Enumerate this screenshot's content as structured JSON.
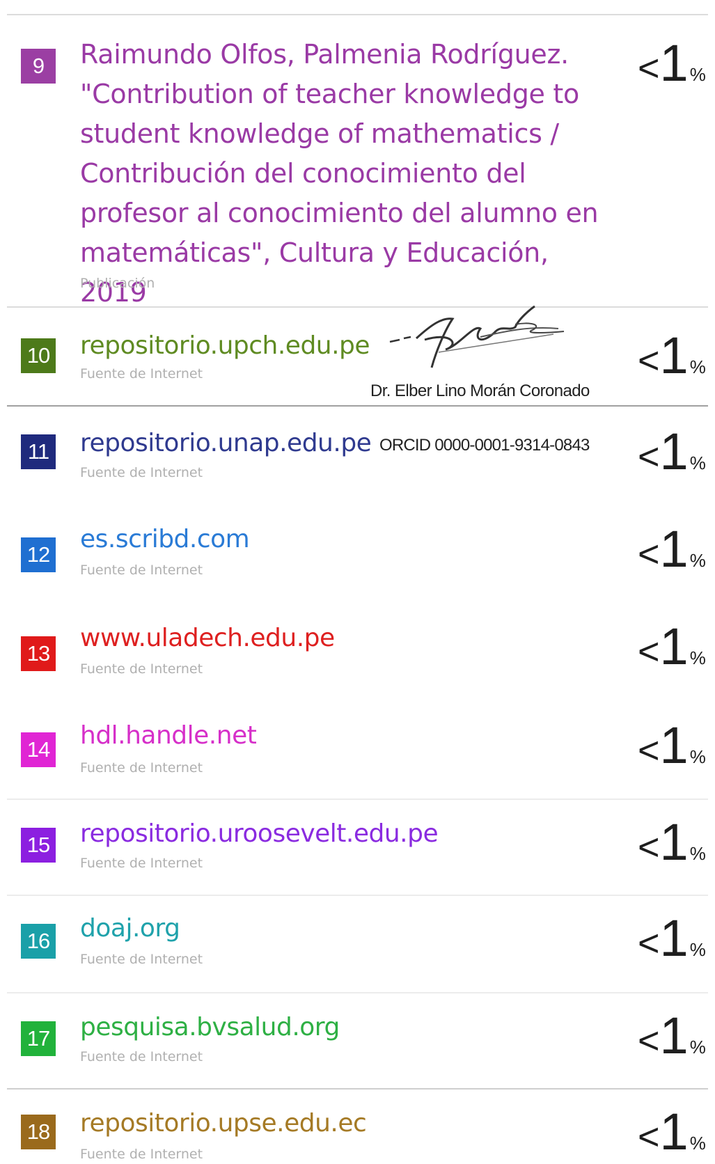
{
  "entries": [
    {
      "num": "9",
      "color": "#9b3fa3",
      "title": "Raimundo Olfos, Palmenia Rodríguez. \"Contribution of teacher knowledge to student knowledge of mathematics / Contribución del conocimiento del profesor al conocimiento del alumno en matemáticas\", Cultura y Educación, 2019",
      "type": "Publicación",
      "pct_lt": "<",
      "pct_num": "1",
      "pct_sym": "%"
    },
    {
      "num": "10",
      "color": "#4d7a1a",
      "title": "repositorio.upch.edu.pe",
      "type": "Fuente de Internet",
      "pct_lt": "<",
      "pct_num": "1",
      "pct_sym": "%"
    },
    {
      "num": "11",
      "color": "#1f2a7d",
      "title": "repositorio.unap.edu.pe",
      "type": "Fuente de Internet",
      "pct_lt": "<",
      "pct_num": "1",
      "pct_sym": "%"
    },
    {
      "num": "12",
      "color": "#1f6fd1",
      "title": "es.scribd.com",
      "type": "Fuente de Internet",
      "pct_lt": "<",
      "pct_num": "1",
      "pct_sym": "%"
    },
    {
      "num": "13",
      "color": "#e01a1a",
      "title": "www.uladech.edu.pe",
      "type": "Fuente de Internet",
      "pct_lt": "<",
      "pct_num": "1",
      "pct_sym": "%"
    },
    {
      "num": "14",
      "color": "#e025d4",
      "title": "hdl.handle.net",
      "type": "Fuente de Internet",
      "pct_lt": "<",
      "pct_num": "1",
      "pct_sym": "%"
    },
    {
      "num": "15",
      "color": "#8c1fe0",
      "title": "repositorio.uroosevelt.edu.pe",
      "type": "Fuente de Internet",
      "pct_lt": "<",
      "pct_num": "1",
      "pct_sym": "%"
    },
    {
      "num": "16",
      "color": "#1aa0a8",
      "title": "doaj.org",
      "type": "Fuente de Internet",
      "pct_lt": "<",
      "pct_num": "1",
      "pct_sym": "%"
    },
    {
      "num": "17",
      "color": "#21b23b",
      "title": "pesquisa.bvsalud.org",
      "type": "Fuente de Internet",
      "pct_lt": "<",
      "pct_num": "1",
      "pct_sym": "%"
    },
    {
      "num": "18",
      "color": "#9a6a1c",
      "title": "repositorio.upse.edu.ec",
      "type": "Fuente de Internet",
      "pct_lt": "<",
      "pct_num": "1",
      "pct_sym": "%"
    }
  ],
  "signature": {
    "name": "Dr. Elber Lino Morán Coronado",
    "orcid": "ORCID 0000-0001-9314-0843"
  },
  "colors": {
    "rule": "#dcdcdc",
    "subtitle": "#b0b0b0",
    "percent": "#1e1e1e"
  }
}
